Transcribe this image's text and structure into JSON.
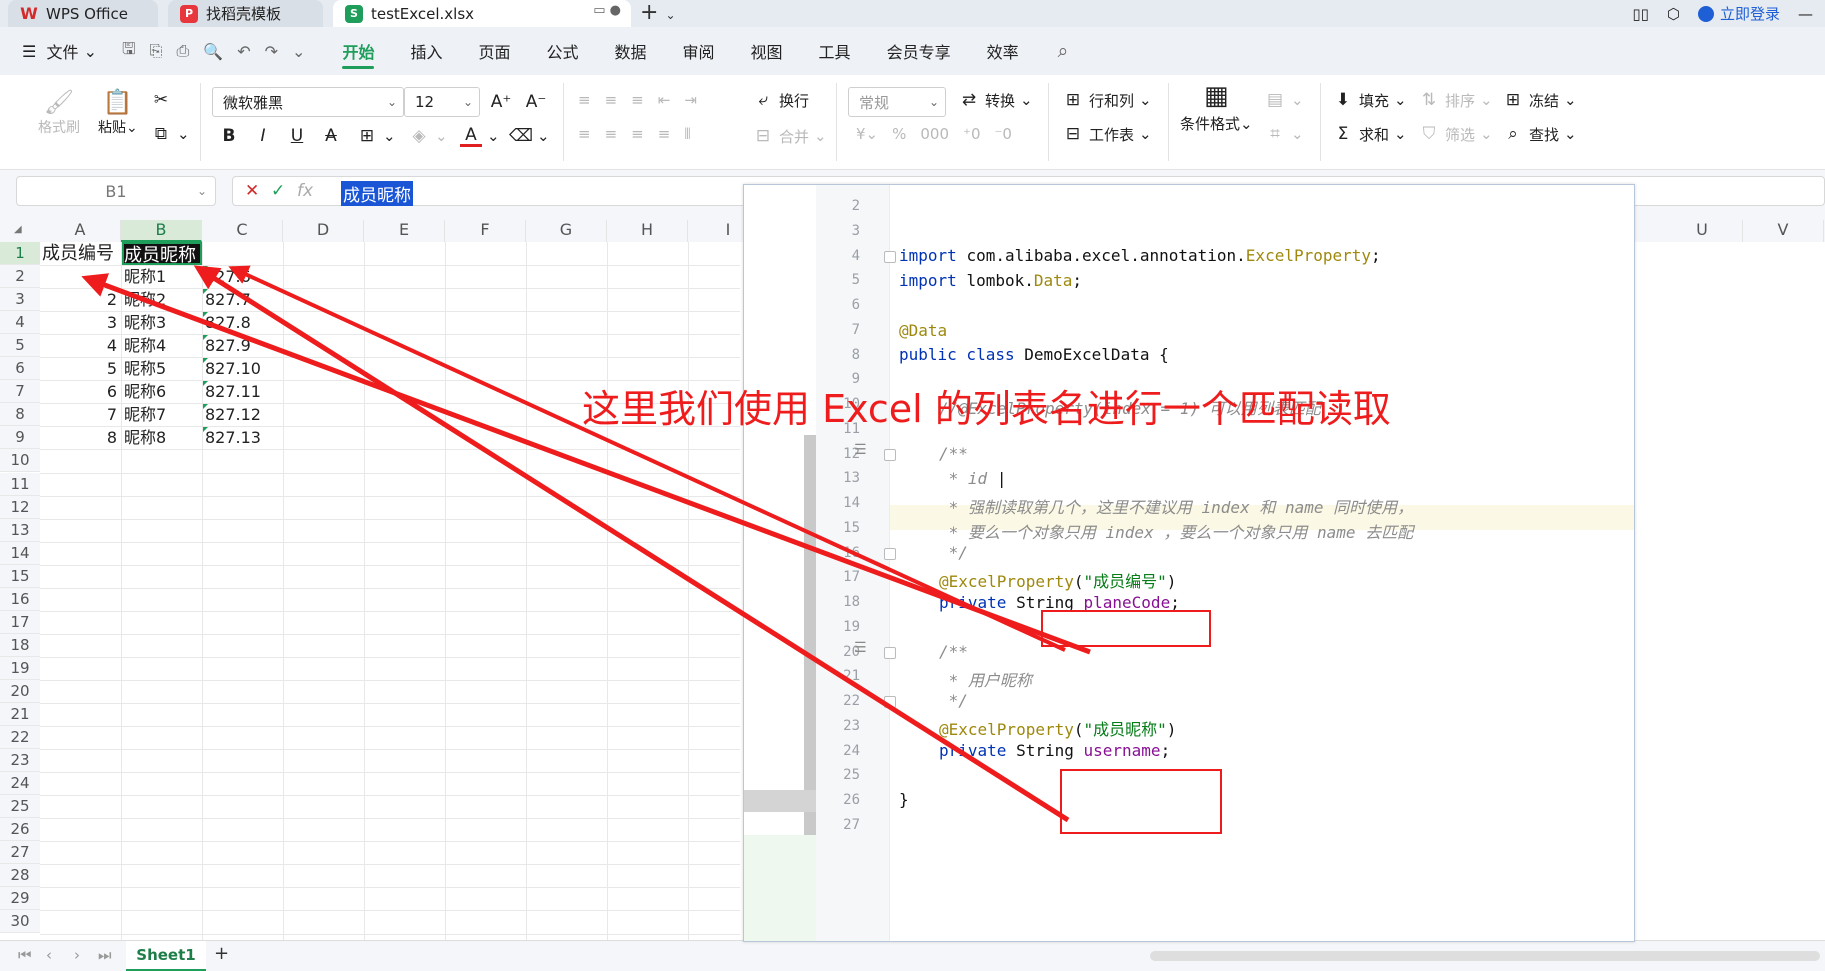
{
  "titlebar": {
    "tabs": [
      {
        "label": "WPS Office",
        "icon": "W"
      },
      {
        "label": "找稻壳模板",
        "icon": "P"
      },
      {
        "label": "testExcel.xlsx",
        "icon": "S"
      }
    ],
    "login": "立即登录"
  },
  "menu": {
    "file": "文件",
    "items": [
      "开始",
      "插入",
      "页面",
      "公式",
      "数据",
      "审阅",
      "视图",
      "工具",
      "会员专享",
      "效率"
    ],
    "active": "开始"
  },
  "ribbon": {
    "format_painter": "格式刷",
    "paste": "粘贴",
    "font": "微软雅黑",
    "font_size": "12",
    "wrap": "换行",
    "merge": "合并",
    "number_format": "常规",
    "convert": "转换",
    "row_col": "行和列",
    "worksheet": "工作表",
    "cond_format": "条件格式",
    "fill": "填充",
    "sort": "排序",
    "freeze": "冻结",
    "sum": "求和",
    "filter": "筛选",
    "find": "查找"
  },
  "formula": {
    "cell_ref": "B1",
    "fx": "fx",
    "content": "成员昵称"
  },
  "grid": {
    "columns": [
      "A",
      "B",
      "C",
      "D",
      "E",
      "F",
      "G",
      "H",
      "I",
      "U",
      "V"
    ],
    "rows": [
      "1",
      "2",
      "3",
      "4",
      "5",
      "6",
      "7",
      "8",
      "9",
      "10",
      "11",
      "12",
      "13",
      "14",
      "15",
      "16",
      "17",
      "18",
      "19",
      "20",
      "21",
      "22",
      "23",
      "24",
      "25",
      "26",
      "27",
      "28",
      "29",
      "30"
    ],
    "header": [
      "成员编号",
      "成员昵称"
    ],
    "data": [
      {
        "a": "",
        "b": "昵称1",
        "c": "827.6"
      },
      {
        "a": "2",
        "b": "昵称2",
        "c": "827.7"
      },
      {
        "a": "3",
        "b": "昵称3",
        "c": "827.8"
      },
      {
        "a": "4",
        "b": "昵称4",
        "c": "827.9"
      },
      {
        "a": "5",
        "b": "昵称5",
        "c": "827.10"
      },
      {
        "a": "6",
        "b": "昵称6",
        "c": "827.11"
      },
      {
        "a": "7",
        "b": "昵称7",
        "c": "827.12"
      },
      {
        "a": "8",
        "b": "昵称8",
        "c": "827.13"
      }
    ]
  },
  "sheet": {
    "tab": "Sheet1"
  },
  "editor": {
    "line_numbers": [
      "2",
      "3",
      "4",
      "5",
      "6",
      "7",
      "8",
      "9",
      "10",
      "11",
      "12",
      "13",
      "14",
      "15",
      "16",
      "17",
      "18",
      "19",
      "20",
      "21",
      "22",
      "23",
      "24",
      "25",
      "26",
      "27"
    ],
    "import1_pkg": "com.alibaba.excel.annotation.",
    "import1_cls": "ExcelProperty",
    "import2_pkg": "lombok.",
    "import2_cls": "Data",
    "annot_data": "@Data",
    "class_decl": "DemoExcelData {",
    "comment_index": "//@ExcelProperty(index = 1) 可以用列表匹配",
    "doc_open": "/**",
    "doc_id": " * id",
    "doc_line1": " * 强制读取第几个，这里不建议用 index 和 name 同时使用，",
    "doc_line2": " * 要么一个对象只用 index ，要么一个对象只用 name 去匹配",
    "doc_close": " */",
    "prop1_annot": "@ExcelProperty",
    "prop1_arg": "\"成员编号\"",
    "field1_name": "planeCode",
    "doc_name": " * 用户昵称",
    "prop2_arg": "\"成员昵称\"",
    "field2_name": "username",
    "closing": "}"
  },
  "annotation": "这里我们使用 Excel 的列表名进行一个匹配读取",
  "colors": {
    "accent": "#1e9e5a",
    "annotation_red": "#ee1c1c"
  }
}
